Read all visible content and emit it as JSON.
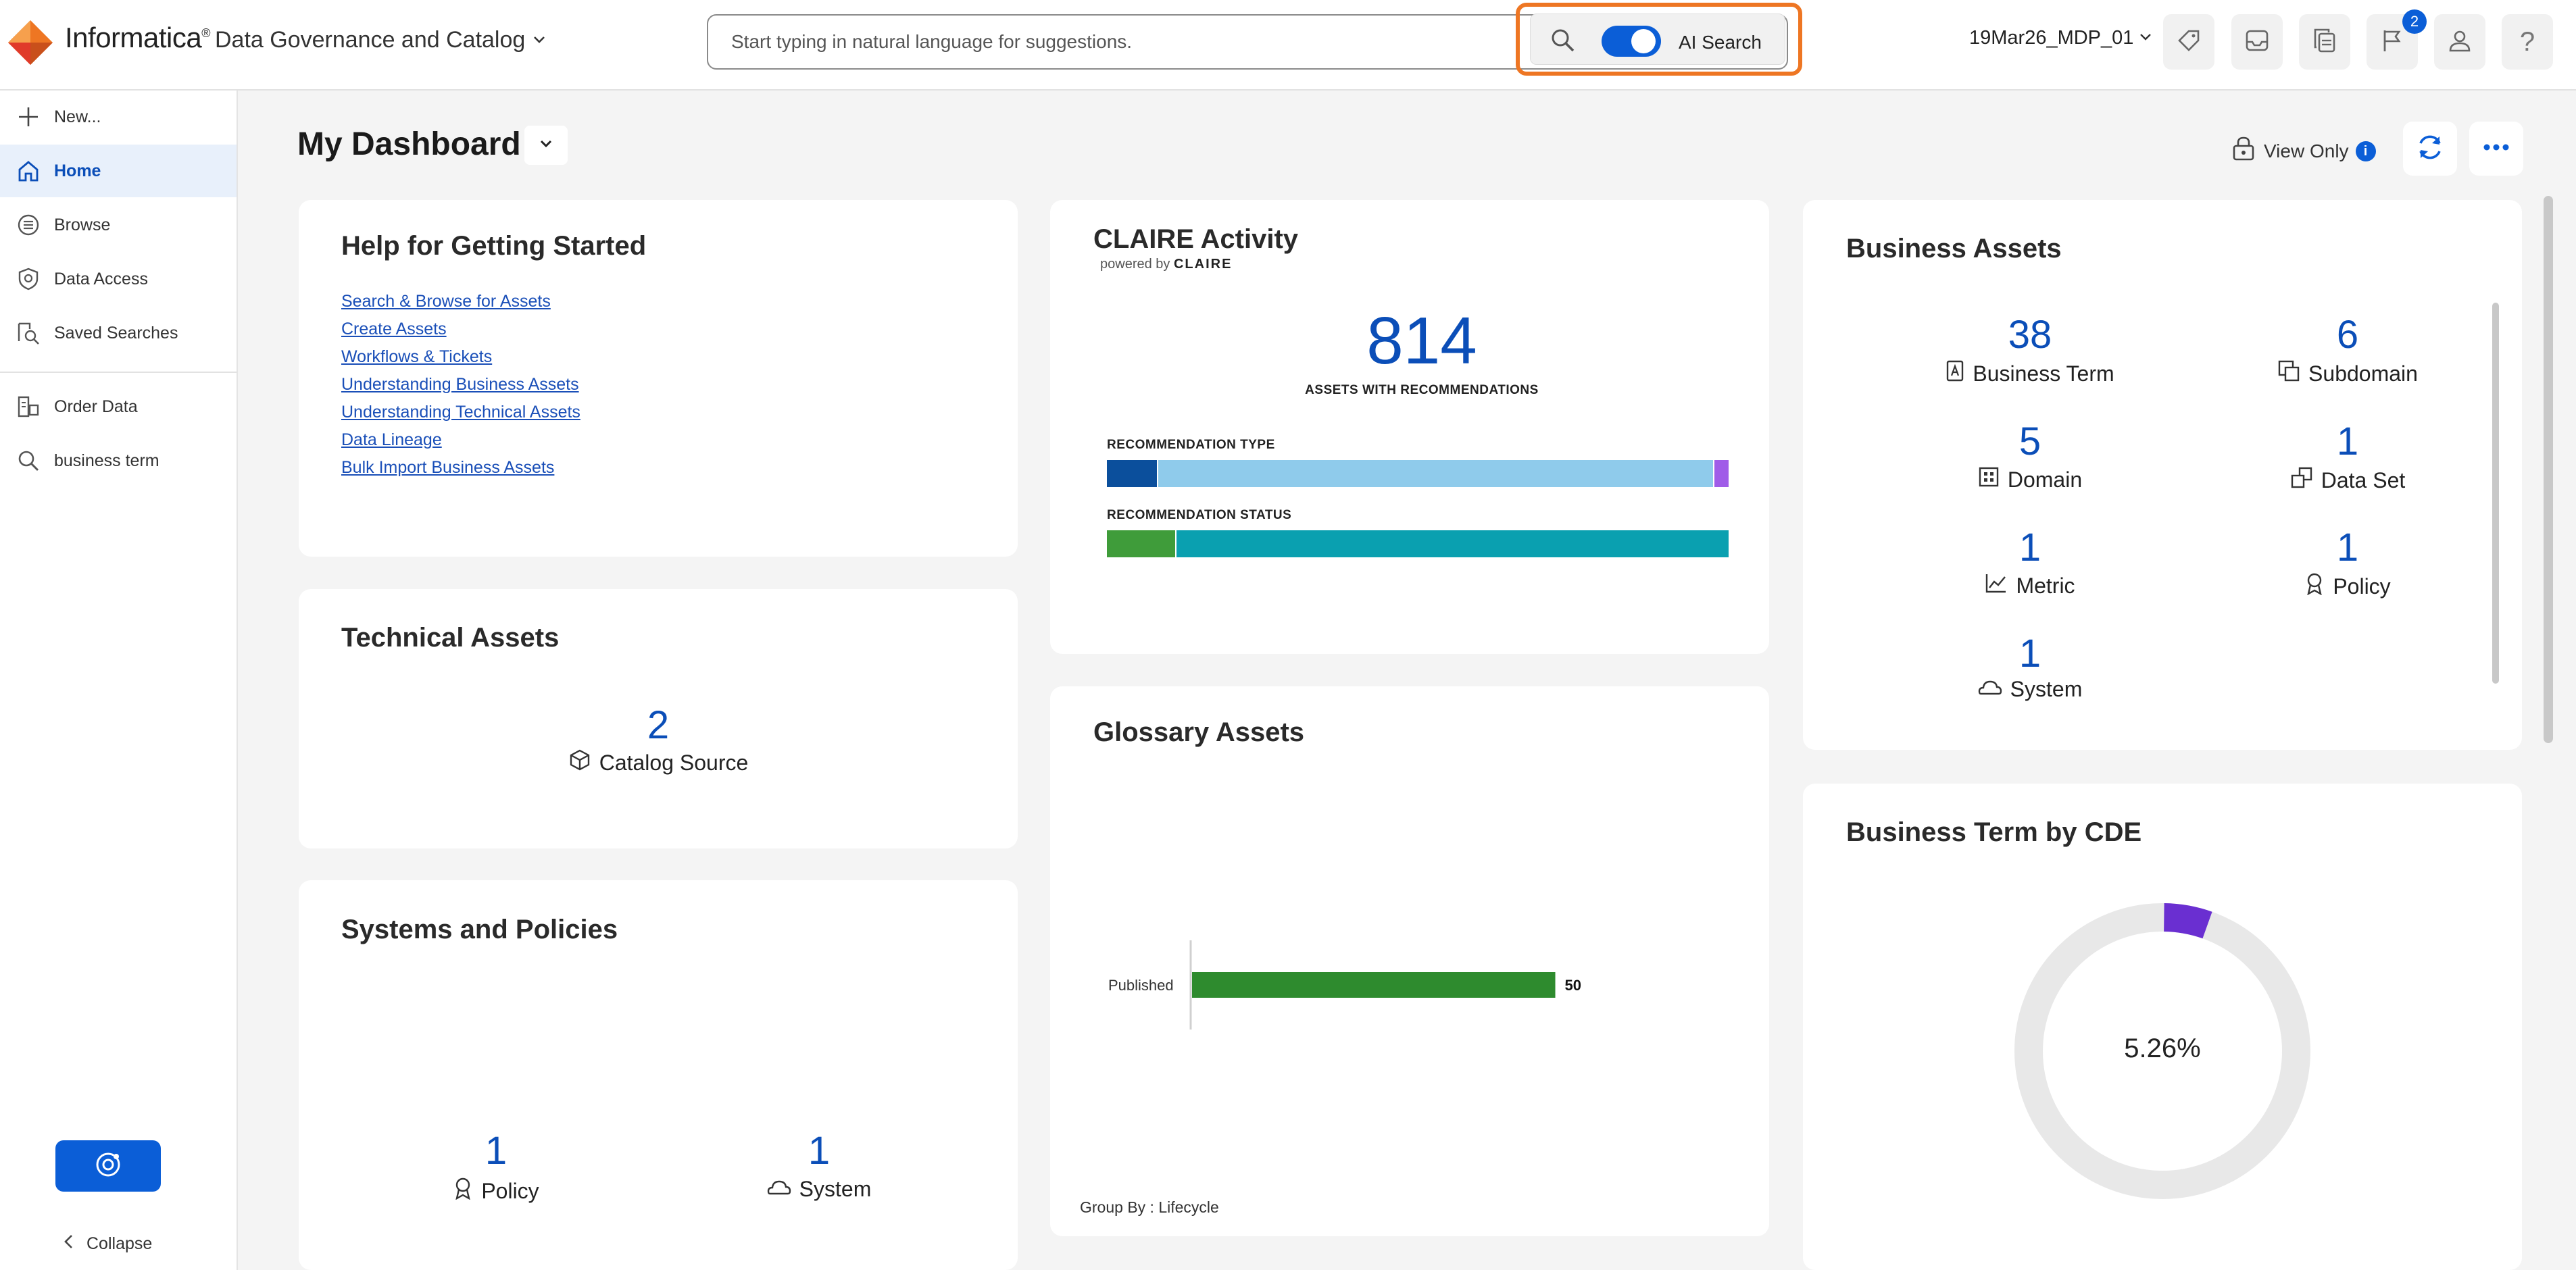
{
  "header": {
    "brand": "Informatica",
    "product": "Data Governance and Catalog",
    "search_placeholder": "Start typing in natural language for suggestions.",
    "ai_search_label": "AI Search",
    "ai_search_enabled": true,
    "org": "19Mar26_MDP_01",
    "notification_count": "2",
    "icons": [
      "tag-icon",
      "inbox-icon",
      "copy-icon",
      "flag-icon",
      "user-icon",
      "help-icon"
    ]
  },
  "sidebar": {
    "items": [
      {
        "label": "New...",
        "icon": "plus-icon"
      },
      {
        "label": "Home",
        "icon": "home-icon",
        "active": true
      },
      {
        "label": "Browse",
        "icon": "browse-icon"
      },
      {
        "label": "Data Access",
        "icon": "shield-icon"
      },
      {
        "label": "Saved Searches",
        "icon": "saved-search-icon"
      },
      {
        "label": "Order Data",
        "icon": "order-data-icon"
      },
      {
        "label": "business term",
        "icon": "search-icon"
      }
    ],
    "collapse_label": "Collapse"
  },
  "dashboard": {
    "title": "My Dashboard",
    "view_only_label": "View Only"
  },
  "help": {
    "title": "Help for Getting Started",
    "links": [
      "Search & Browse for Assets",
      "Create Assets",
      "Workflows & Tickets",
      "Understanding Business Assets",
      "Understanding Technical Assets",
      "Data Lineage",
      "Bulk Import Business Assets"
    ]
  },
  "claire": {
    "title": "CLAIRE Activity",
    "powered_by": "powered by",
    "claire_brand": "CLAIRE",
    "count": "814",
    "count_label": "ASSETS WITH RECOMMENDATIONS",
    "rec_type_label": "RECOMMENDATION TYPE",
    "rec_type_segments": [
      {
        "fraction": 0.08,
        "color": "#0b4f9c"
      },
      {
        "fraction": 0.895,
        "color": "#8fcbeb"
      },
      {
        "fraction": 0.025,
        "color": "#a05ce8"
      }
    ],
    "rec_status_label": "RECOMMENDATION STATUS",
    "rec_status_segments": [
      {
        "fraction": 0.11,
        "color": "#3f9c3a"
      },
      {
        "fraction": 0.89,
        "color": "#0aa0b0"
      }
    ]
  },
  "business_assets": {
    "title": "Business Assets",
    "items": [
      {
        "value": "38",
        "label": "Business Term",
        "icon": "business-term-icon"
      },
      {
        "value": "6",
        "label": "Subdomain",
        "icon": "subdomain-icon"
      },
      {
        "value": "5",
        "label": "Domain",
        "icon": "domain-icon"
      },
      {
        "value": "1",
        "label": "Data Set",
        "icon": "data-set-icon"
      },
      {
        "value": "1",
        "label": "Metric",
        "icon": "metric-icon"
      },
      {
        "value": "1",
        "label": "Policy",
        "icon": "policy-icon"
      },
      {
        "value": "1",
        "label": "System",
        "icon": "system-icon"
      }
    ]
  },
  "technical_assets": {
    "title": "Technical Assets",
    "value": "2",
    "label": "Catalog Source"
  },
  "glossary": {
    "title": "Glossary Assets",
    "group_by": "Group By : Lifecycle"
  },
  "chart_data": {
    "type": "bar",
    "orientation": "horizontal",
    "categories": [
      "Published"
    ],
    "values": [
      50
    ],
    "color": "#2e8b2e",
    "xlim": [
      0,
      55
    ]
  },
  "systems_policies": {
    "title": "Systems and Policies",
    "items": [
      {
        "value": "1",
        "label": "Policy",
        "icon": "policy-icon"
      },
      {
        "value": "1",
        "label": "System",
        "icon": "system-icon"
      }
    ]
  },
  "cde": {
    "title": "Business Term by CDE",
    "percent_label": "5.26%",
    "fraction": 0.0526,
    "colors": {
      "track": "#e8e8e8",
      "fill": "#6a2fd1"
    }
  }
}
